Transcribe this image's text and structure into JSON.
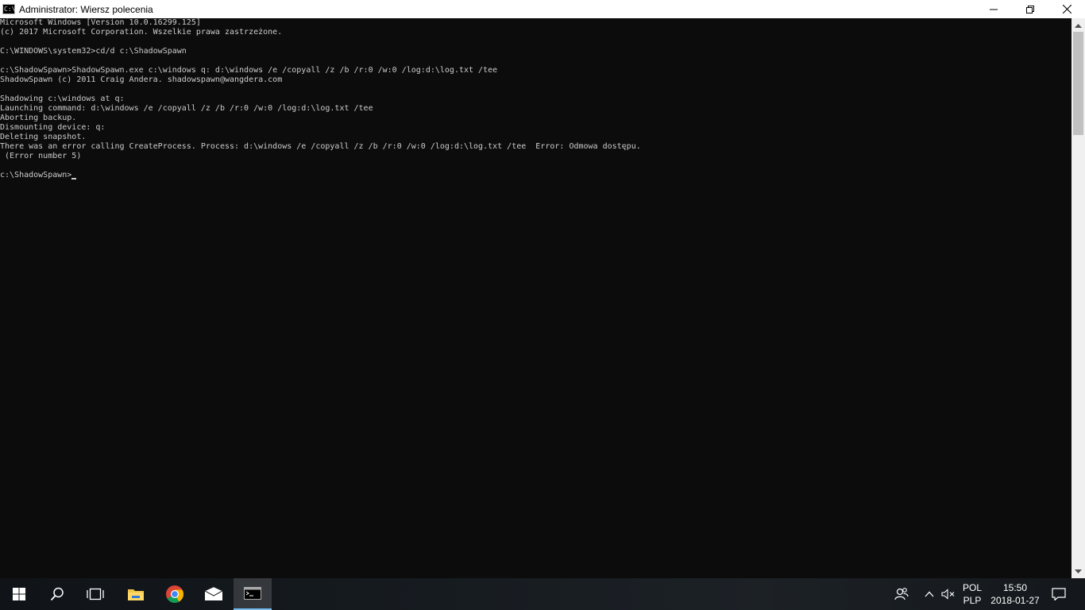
{
  "window": {
    "title": "Administrator: Wiersz polecenia",
    "icon": "cmd-icon",
    "icon_glyph": "C:\\"
  },
  "console": {
    "lines": [
      "Microsoft Windows [Version 10.0.16299.125]",
      "(c) 2017 Microsoft Corporation. Wszelkie prawa zastrzeżone.",
      "",
      "C:\\WINDOWS\\system32>cd/d c:\\ShadowSpawn",
      "",
      "c:\\ShadowSpawn>ShadowSpawn.exe c:\\windows q: d:\\windows /e /copyall /z /b /r:0 /w:0 /log:d:\\log.txt /tee",
      "ShadowSpawn (c) 2011 Craig Andera. shadowspawn@wangdera.com",
      "",
      "Shadowing c:\\windows at q:",
      "Launching command: d:\\windows /e /copyall /z /b /r:0 /w:0 /log:d:\\log.txt /tee",
      "Aborting backup.",
      "Dismounting device: q:",
      "Deleting snapshot.",
      "There was an error calling CreateProcess. Process: d:\\windows /e /copyall /z /b /r:0 /w:0 /log:d:\\log.txt /tee  Error: Odmowa dostępu.",
      " (Error number 5)",
      ""
    ],
    "prompt": "c:\\ShadowSpawn>"
  },
  "taskbar": {
    "language_top": "POL",
    "language_bottom": "PLP",
    "time": "15:50",
    "date": "2018-01-27"
  },
  "colors": {
    "console_bg": "#0c0c0c",
    "console_fg": "#cccccc",
    "active_indicator": "#76b9ed"
  }
}
